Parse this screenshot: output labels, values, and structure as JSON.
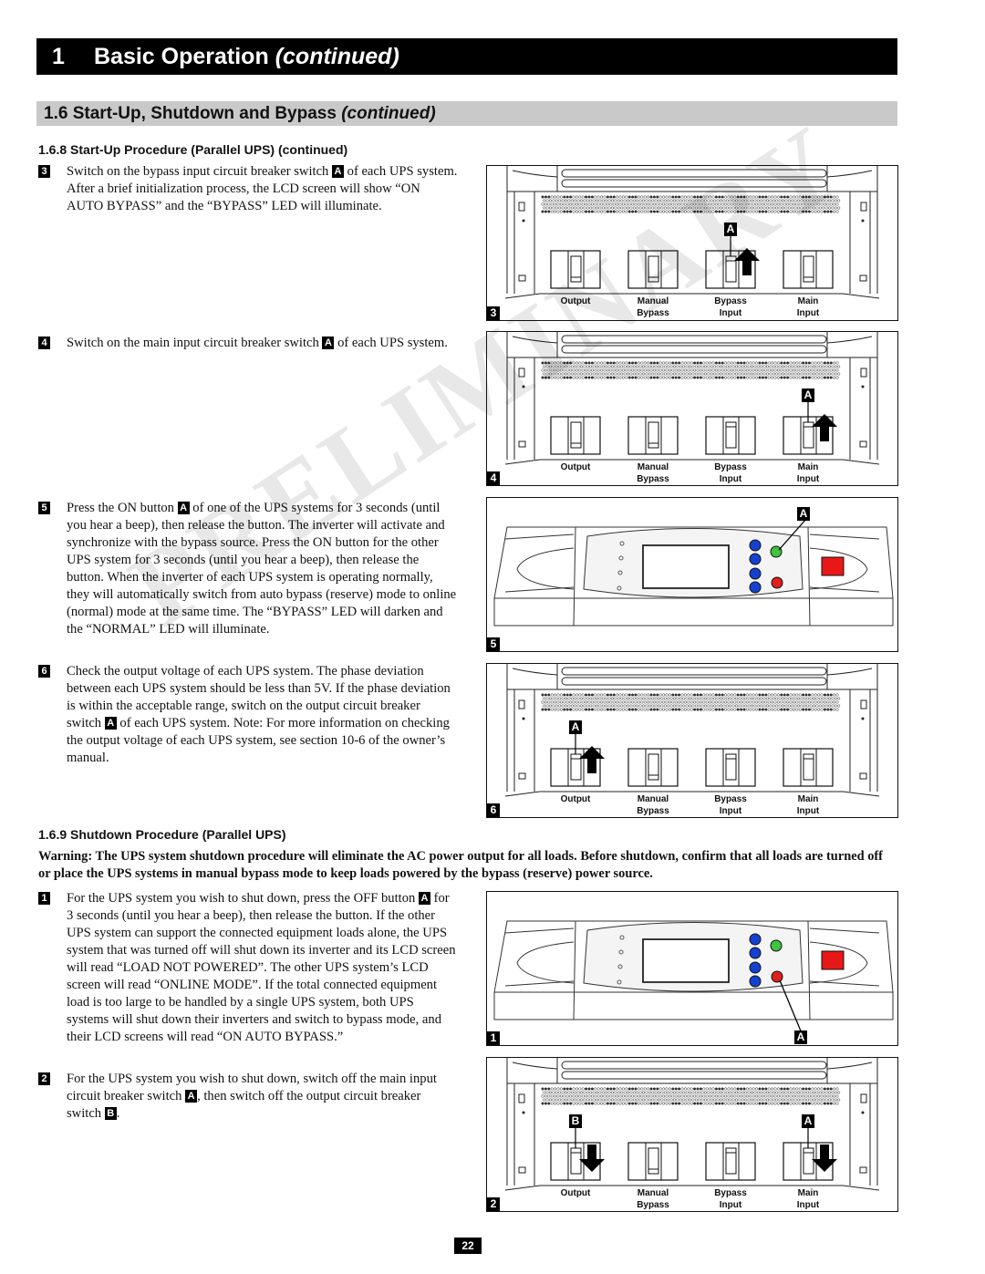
{
  "chapter": {
    "number": "1",
    "title": "Basic Operation",
    "title_suffix": "(continued)"
  },
  "section": {
    "title": "1.6 Start-Up, Shutdown and Bypass",
    "title_suffix": "(continued)"
  },
  "startup": {
    "heading": "1.6.8 Start-Up Procedure (Parallel UPS) (continued)",
    "steps": [
      {
        "num": "3",
        "parts": [
          "Switch on the bypass input circuit breaker switch ",
          "A",
          " of each UPS system. After a brief initialization process, the LCD screen will show “ON AUTO BYPASS” and the “BYPASS” LED will illuminate."
        ]
      },
      {
        "num": "4",
        "parts": [
          "Switch on the main input circuit breaker switch ",
          "A",
          " of each UPS system."
        ]
      },
      {
        "num": "5",
        "parts": [
          "Press the ON button ",
          "A",
          " of one of the UPS systems for 3 seconds (until you hear a beep), then release the button. The inverter will activate and synchronize with the bypass source. Press the ON button for the other UPS system for 3 seconds (until you hear a beep), then release the button. When the inverter of each UPS system is operating normally, they will automatically switch from auto bypass (reserve) mode to online (normal) mode at the same time. The “BYPASS” LED will darken and the “NORMAL” LED will illuminate."
        ]
      },
      {
        "num": "6",
        "parts": [
          "Check the output voltage of each UPS system. The phase deviation between each UPS system should be less than 5V. If the phase deviation is within the acceptable range, switch on the output circuit breaker switch ",
          "A",
          " of each UPS system. Note: For more information on checking the output voltage of each UPS system, see section 10-6 of the owner’s manual."
        ]
      }
    ]
  },
  "shutdown": {
    "heading": "1.6.9 Shutdown Procedure (Parallel UPS)",
    "warning": "Warning: The UPS system shutdown procedure will eliminate the AC power output for all loads. Before shutdown, confirm that all loads are turned off or place the UPS systems in manual bypass mode to keep loads powered by the bypass (reserve) power source.",
    "steps": [
      {
        "num": "1",
        "parts": [
          "For the UPS system you wish to shut down, press the OFF button ",
          "A",
          " for 3 seconds (until you hear a beep), then release the button. If the other UPS system can support the connected equipment loads alone, the UPS system that was turned off will shut down its inverter and its LCD screen will read “LOAD NOT POWERED”. The other UPS system’s LCD screen will read “ONLINE MODE”. If the total connected equipment load is too large to be handled by a single UPS system, both UPS systems will shut down their inverters and switch to bypass mode, and their LCD screens will read “ON AUTO BYPASS.”"
        ]
      },
      {
        "num": "2",
        "parts": [
          "For the UPS system you wish to shut down, switch off the main input circuit breaker switch ",
          "A",
          ", then switch off the output circuit breaker switch ",
          "B",
          "."
        ]
      }
    ]
  },
  "breaker_labels": [
    {
      "line1": "Output",
      "line2": ""
    },
    {
      "line1": "Manual",
      "line2": "Bypass"
    },
    {
      "line1": "Bypass",
      "line2": "Input"
    },
    {
      "line1": "Main",
      "line2": "Input"
    }
  ],
  "figures": {
    "fig3": {
      "num": "3",
      "callouts": [
        "A"
      ],
      "switch_states": [
        "off",
        "off",
        "on",
        "off"
      ],
      "arrows": [
        {
          "breaker": 2,
          "direction": "up"
        }
      ]
    },
    "fig4": {
      "num": "4",
      "callouts": [
        "A"
      ],
      "switch_states": [
        "off",
        "off",
        "on",
        "on"
      ],
      "arrows": [
        {
          "breaker": 3,
          "direction": "up"
        }
      ]
    },
    "fig5": {
      "num": "5",
      "callouts": [
        "A"
      ],
      "pointed_button": "on-button-green"
    },
    "fig6": {
      "num": "6",
      "callouts": [
        "A"
      ],
      "switch_states": [
        "on",
        "off",
        "on",
        "on"
      ],
      "arrows": [
        {
          "breaker": 0,
          "direction": "up"
        }
      ]
    },
    "fig1": {
      "num": "1",
      "callouts": [
        "A"
      ],
      "pointed_button": "off-button-red"
    },
    "fig2": {
      "num": "2",
      "callouts": [
        "B",
        "A"
      ],
      "switch_states": [
        "on",
        "off",
        "on",
        "on"
      ],
      "arrows": [
        {
          "breaker": 0,
          "direction": "down"
        },
        {
          "breaker": 3,
          "direction": "down"
        }
      ]
    }
  },
  "colors": {
    "on_button": "#3ec43e",
    "off_button": "#e0201e",
    "nav_buttons": "#1541d0",
    "epo_button": "#e81818"
  },
  "watermark": "PRELIMINARY",
  "page_number": "22"
}
